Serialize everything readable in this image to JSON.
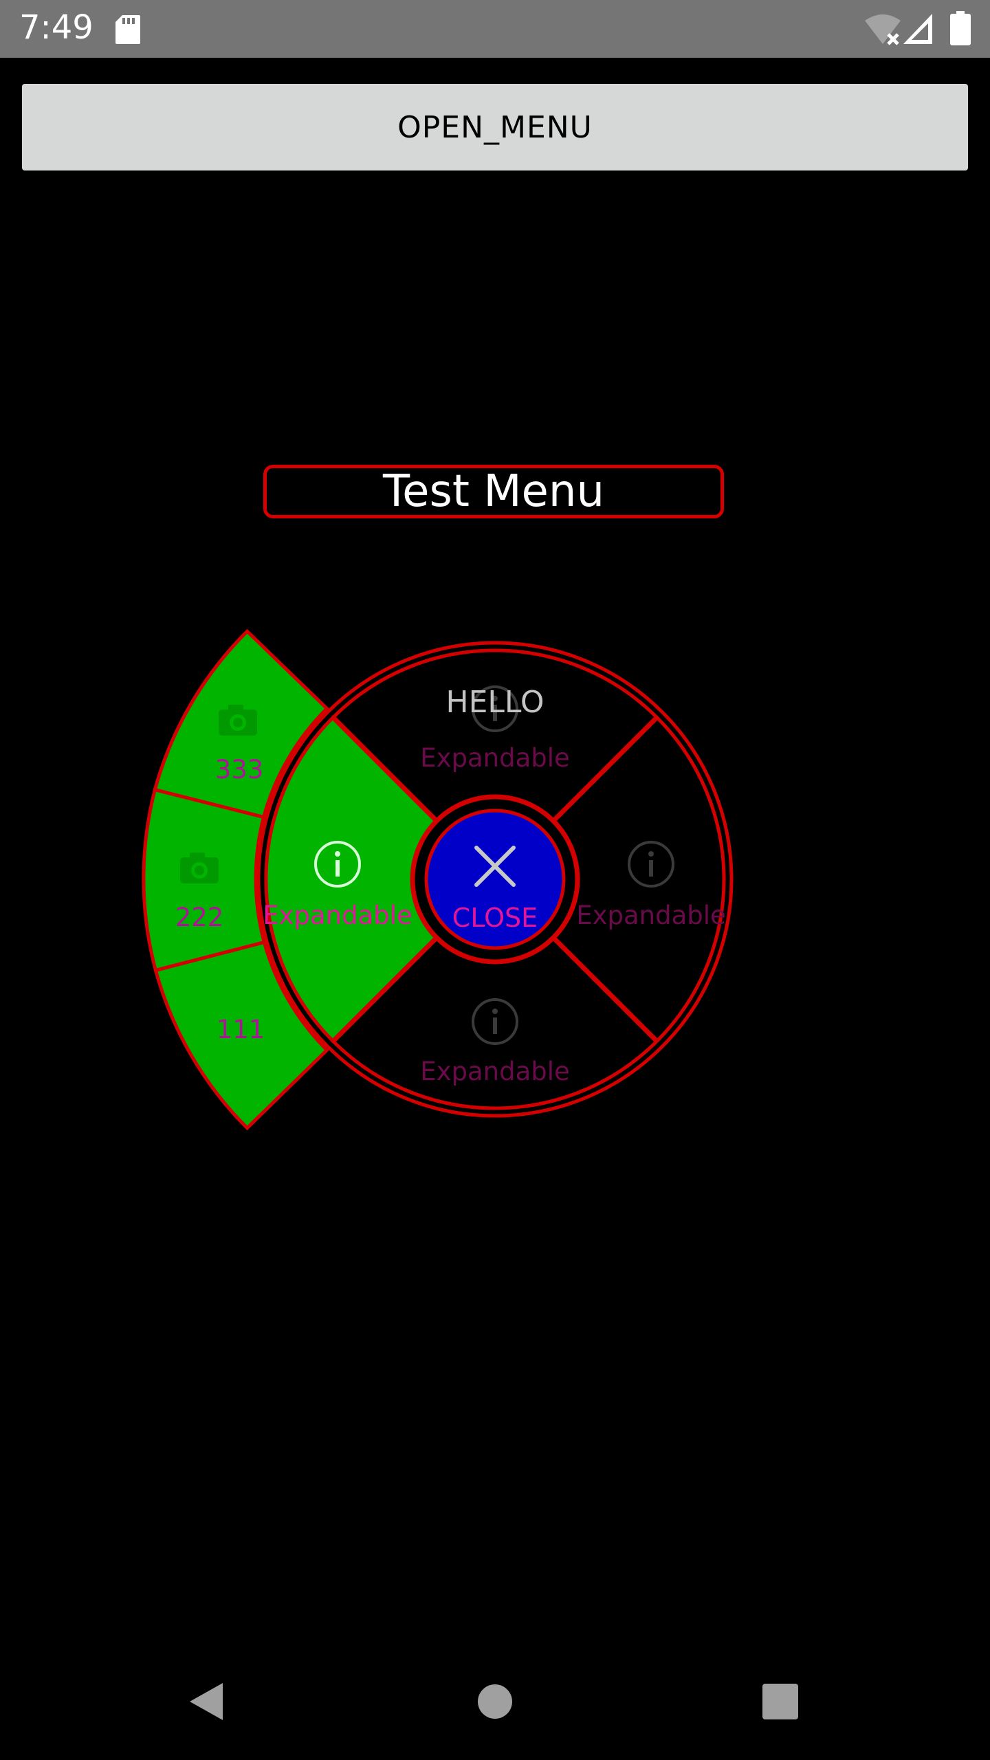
{
  "status_bar": {
    "time": "7:49",
    "icons": [
      "sd-card-icon",
      "wifi-off-icon",
      "signal-icon",
      "battery-icon"
    ]
  },
  "open_menu_button": {
    "label": "OPEN_MENU"
  },
  "menu": {
    "title": "Test Menu",
    "center": {
      "label": "CLOSE",
      "icon": "close-icon"
    },
    "items": [
      {
        "position": "top",
        "header": "HELLO",
        "label": "Expandable",
        "icon": "info-icon"
      },
      {
        "position": "left",
        "label": "Expandable",
        "icon": "info-icon",
        "expanded": true
      },
      {
        "position": "right",
        "label": "Expandable",
        "icon": "info-icon"
      },
      {
        "position": "bottom",
        "label": "Expandable",
        "icon": "info-icon"
      }
    ],
    "sub_items": [
      {
        "label": "333",
        "icon": "camera-icon"
      },
      {
        "label": "222",
        "icon": "camera-icon"
      },
      {
        "label": "111"
      }
    ]
  },
  "colors": {
    "border": "#d40000",
    "expanded_fill": "#00b400",
    "center_fill": "#0000c8",
    "label_active": "#e0179b",
    "label_dim": "#6b0a4a"
  },
  "nav_bar": {
    "icons": [
      "back-icon",
      "home-icon",
      "recents-icon"
    ]
  }
}
